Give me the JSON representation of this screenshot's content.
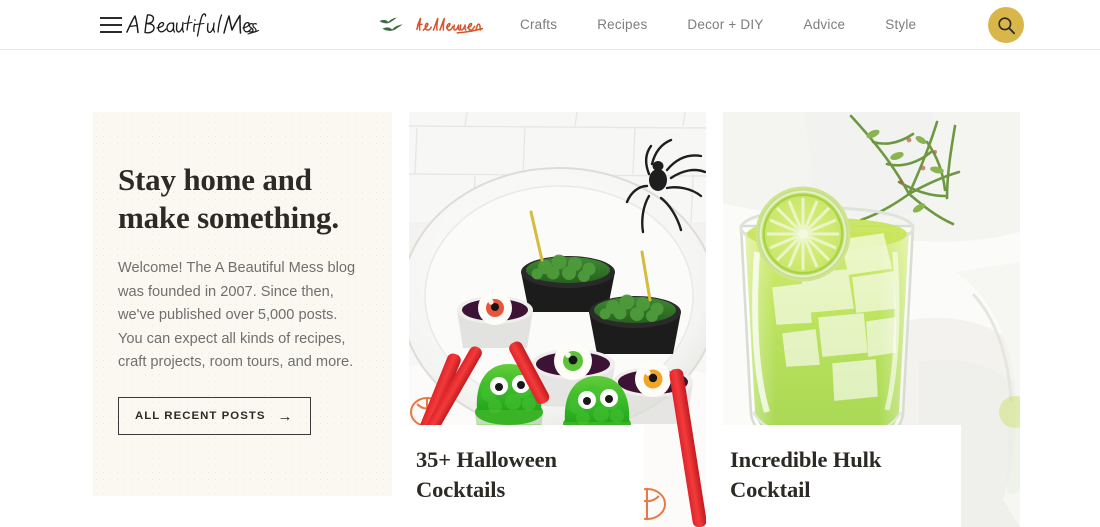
{
  "site": {
    "logo_text": "A Beautiful Mess",
    "logo_name": "a-beautiful-mess-logo"
  },
  "header": {
    "menu_icon": "hamburger-menu-icon",
    "search_icon": "search-icon",
    "search_button_color": "#d9b649",
    "nav": [
      {
        "label": "Halloween",
        "icon": "bats-icon",
        "featured": true,
        "color": "#d4552c"
      },
      {
        "label": "Crafts",
        "featured": false
      },
      {
        "label": "Recipes",
        "featured": false
      },
      {
        "label": "Decor + DIY",
        "featured": false
      },
      {
        "label": "Advice",
        "featured": false
      },
      {
        "label": "Style",
        "featured": false
      }
    ]
  },
  "hero": {
    "title": "Stay home and make something.",
    "body": "Welcome! The A Beautiful Mess blog was founded in 2007. Since then, we've published over 5,000 posts. You can expect all kinds of recipes, craft projects, room tours, and more.",
    "cta_label": "ALL RECENT POSTS",
    "cta_arrow": "→",
    "background_color": "#fbf8f1"
  },
  "posts": [
    {
      "title": "35+ Halloween Cocktails",
      "image_alt": "halloween-jello-cups-photo"
    },
    {
      "title": "Incredible Hulk Cocktail",
      "image_alt": "green-cocktail-photo"
    }
  ]
}
